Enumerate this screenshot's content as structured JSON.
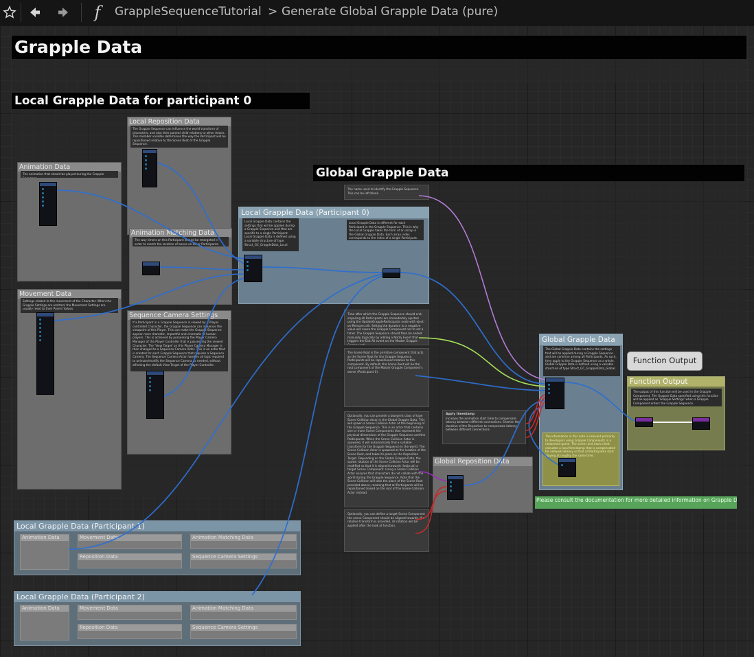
{
  "toolbar": {
    "star_icon": "star-icon",
    "back_icon": "back-arrow-icon",
    "forward_icon": "forward-arrow-icon",
    "function_icon": "function-icon",
    "function_glyph": "f",
    "breadcrumb_root": "GrappleSequenceTutorial",
    "breadcrumb_separator": ">",
    "breadcrumb_current": "Generate Global Grapple Data (pure)"
  },
  "comments": {
    "main": "Grapple Data",
    "local": "Local Grapple Data for participant 0",
    "global": "Global Grapple Data"
  },
  "local_nodes": {
    "local_reposition": {
      "title": "Local Reposition Data",
      "text": "The Grapple Sequence can influence the world transform of characters, and also their parent/ child relations to other Actors. This member variable determines the way the Participant will be repositioned relative to the Scene Root of the Grapple Sequence."
    },
    "animation": {
      "title": "Animation Data",
      "text": "The animation that should be played during the Grapple Sequence."
    },
    "animation_matching": {
      "title": "Animation Matching Data",
      "text": "The way timers on this Participant should be retargeted in order to match the location of bones on other Participants."
    },
    "movement": {
      "title": "Movement Data",
      "text": "Settings related to the movement of the Character. When the Grapple Settings are omitted, the Movement Settings are usually reset to their Parent Values."
    },
    "sequence_camera": {
      "title": "Sequence Camera Settings",
      "text": "If a Participant in a Grapple Sequence is viewed by a Player-controlled Character, the Grapple Sequence can influence the viewpoint of this Player. This can make the Grapple Sequence appear more dramatic, impactful and cinematic to human players. This is achieved by possessing the Player Camera Manager of the Player Controller that is possessing the viewed Character. The 'View Target' on this Player Camera Manager is then changed to a Sequence Camera Actor. This is an actor that is created for each Grapple Sequence that requires a Sequence Camera. The Sequence Camera Actor handles all logic required to animate/modify the Sequence Camera as needed, without affecting the default View Target of the Player Controller."
    }
  },
  "local_grapple_p0": {
    "title": "Local Grapple Data (Participant 0)",
    "note_left": "Local Grapple Data contains the settings that will be applied during a Grapple Sequence and that are specific to a single Participant. Local Grapple Data is defined using a variable structure of type Struct_GC_GrappleData_Local.",
    "note_right": "Local Grapple Data is different for each Participant in the Grapple Sequence. This is why the Local Grapple takes the form of an array in the Global Grapple Data. Each array index corresponds to the index of a single Participant."
  },
  "global_notes": {
    "name": "The name used to identify the Grapple Sequence. This can be left blank.",
    "timer": "Time after which the Grapple Sequence should end, imposing all Participants are immediately ejected using the UpdateGrappleParticipants node with eject-on-Remove=All. Setting the duration to a negative value will cause the Grapple Component not to set a timer. The Grapple Sequence should then be ended manually (typically by adding a Notify Event that triggers the Exit All event on the Master Grapple Component).",
    "scene_root": "The Scene Root is the primitive component that acts as the Scene Root for the Grapple Sequence. Participants will be repositioned relative to this component. By default, the Scene Root will be the root component of the Master Grapple Component's owner (Participant 0).",
    "collision": "Optionally, you can provide a blueprint class of type Scene Collision Actor in the Global Grapple Data. This will spawn a Scene Collision Actor at the beginning of the Grapple Sequence. This is an actor that contains one or more Scene Components that represent the physical dimensions of the Grapple Sequence and the Participants. When the Scene Collision Actor is spawned, it will automatically find a suitable transform for the Grapple Sequence in the world. The Scene Collision Actor is spawned at the location of the Scene Root, and takes its place as the Reposition Target. Depending on the Global Grapple Data, the spawn rotation of the Scene Collision Actor will be modified so that it is aligned towards (looks at) a target Scene Component. Using a Scene Collision Actor ensures that characters do not collide with the world during the Grapple Sequence. Note that the Scene Collision will take the place of the Scene Root provided above, meaning that all Participants will be repositioned based on the root of the Scene Collision Actor instead.",
    "target": "Optionally, you can define a target Scene Component the scene Component should be aligned towards. If a relative transform is provided, its rotation will be applied after the look at function."
  },
  "apply_note": {
    "title": "Apply timestamp",
    "text": "Increase the animation start time to compensate latency between different connections. Shorten the duration of the Reposition to compensate latency between different connections."
  },
  "global_reposition": {
    "title": "Global Reposition Data"
  },
  "global_grapple": {
    "title": "Global Grapple Data",
    "text": "The Global Grapple Data contains the settings that will be applied during a Grapple Sequence and are common among all Participants. As such, they apply to the Grapple Sequence as a whole. Global Grapple Data is defined using a variable structure of type Struct_GC_GrappleData_Global.",
    "yellow_note": "The information in this note is relevant primarily to developers using Grapple Components in a networked game. The server and each client calculate a local timestamp that is compensated for network latency so that all Participants start playing at roughly the same time."
  },
  "function_output": {
    "tooltip": "Function Output",
    "title": "Function Output",
    "text": "The output of this function will be used in the Grapple Component. The Grapple Data specified using this function will be applied as 'Grapple Settings' when a Grapple Component enters the Grapple Sequence."
  },
  "green_note": "Please consult the documentation for more detailed information on Grapple Data",
  "participant_nodes": [
    {
      "title": "Local Grapple Data (Participant 1)",
      "items": [
        "Animation Data",
        "Movement Data",
        "Animation Matching Data",
        "Reposition Data",
        "Sequence Camera Settings"
      ]
    },
    {
      "title": "Local Grapple Data (Participant 2)",
      "items": [
        "Animation Data",
        "Movement Data",
        "Animation Matching Data",
        "Reposition Data",
        "Sequence Camera Settings"
      ]
    }
  ],
  "colors": {
    "wire_struct": "#2f6fd0",
    "wire_name": "#b37bd6",
    "wire_float": "#a6e05a",
    "wire_transform": "#c62a2a",
    "comment_title_bg": "#020202"
  }
}
